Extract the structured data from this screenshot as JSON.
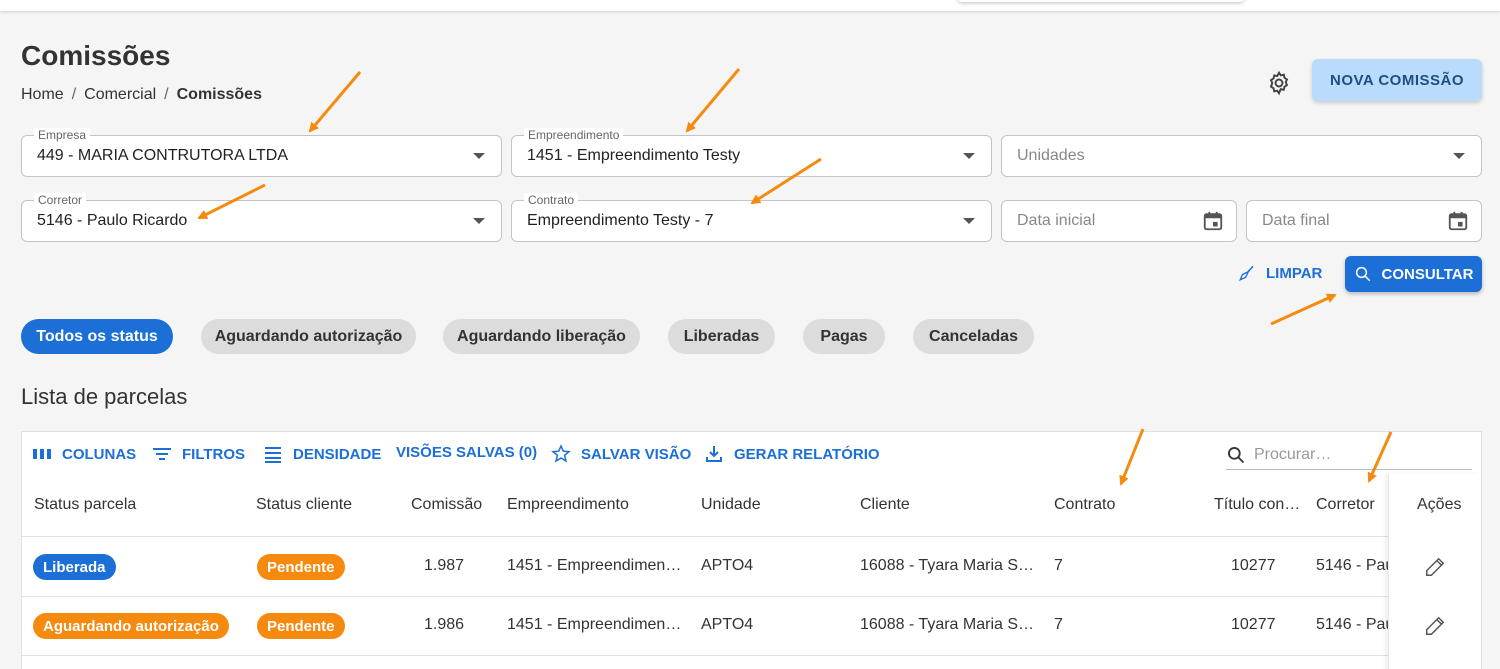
{
  "page": {
    "title": "Comissões",
    "breadcrumb": [
      "Home",
      "Comercial",
      "Comissões"
    ],
    "new_button": "NOVA COMISSÃO"
  },
  "filters": {
    "empresa": {
      "label": "Empresa",
      "value": "449 - MARIA CONTRUTORA LTDA"
    },
    "empreendimento": {
      "label": "Empreendimento",
      "value": "1451 - Empreendimento Testy"
    },
    "unidades": {
      "placeholder": "Unidades"
    },
    "corretor": {
      "label": "Corretor",
      "value": "5146 - Paulo Ricardo"
    },
    "contrato": {
      "label": "Contrato",
      "value": "Empreendimento Testy - 7"
    },
    "data_inicial": {
      "placeholder": "Data inicial"
    },
    "data_final": {
      "placeholder": "Data final"
    },
    "clear_label": "LIMPAR",
    "search_label": "CONSULTAR"
  },
  "status_chips": [
    "Todos os status",
    "Aguardando autorização",
    "Aguardando liberação",
    "Liberadas",
    "Pagas",
    "Canceladas"
  ],
  "list": {
    "title": "Lista de parcelas",
    "toolbar": {
      "columns": "COLUNAS",
      "filters": "FILTROS",
      "density": "DENSIDADE",
      "saved_views": "VISÕES SALVAS (0)",
      "save_view": "SALVAR VISÃO",
      "report": "GERAR RELATÓRIO",
      "search_placeholder": "Procurar…"
    },
    "columns": [
      "Status parcela",
      "Status cliente",
      "Comissão",
      "Empreendimento",
      "Unidade",
      "Cliente",
      "Contrato",
      "Título con…",
      "Corretor",
      "Ações"
    ],
    "rows": [
      {
        "status_parcela": "Liberada",
        "status_cliente": "Pendente",
        "comissao": "1.987",
        "empreendimento": "1451 - Empreendimen…",
        "unidade": "APTO4",
        "cliente": "16088 - Tyara Maria S…",
        "contrato": "7",
        "titulo": "10277",
        "corretor": "5146 - Pau"
      },
      {
        "status_parcela": "Aguardando autorização",
        "status_cliente": "Pendente",
        "comissao": "1.986",
        "empreendimento": "1451 - Empreendimen…",
        "unidade": "APTO4",
        "cliente": "16088 - Tyara Maria S…",
        "contrato": "7",
        "titulo": "10277",
        "corretor": "5146 - Pau"
      }
    ]
  },
  "colors": {
    "primary": "#1b6fd6",
    "orange": "#f68a0f",
    "annotation_arrow": "#f68a0f"
  }
}
